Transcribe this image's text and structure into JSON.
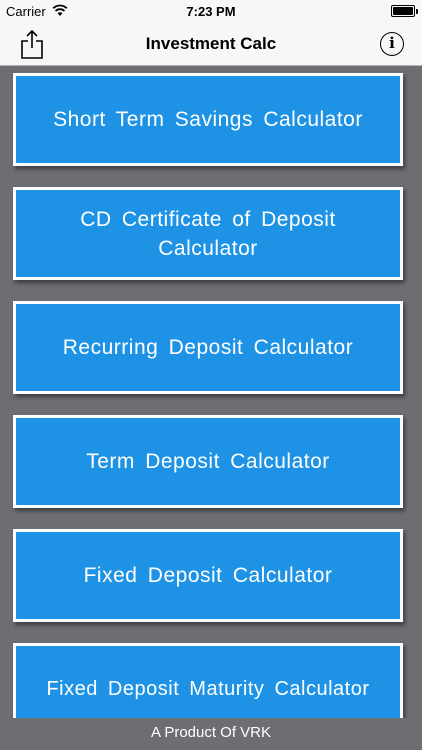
{
  "status_bar": {
    "carrier": "Carrier",
    "time": "7:23 PM"
  },
  "nav": {
    "title": "Investment Calc",
    "share_icon": "share-icon",
    "info_icon": "info-icon",
    "info_glyph": "i"
  },
  "calculators": [
    {
      "label": "Short Term Savings Calculator"
    },
    {
      "label": "CD  Certificate of Deposit\nCalculator"
    },
    {
      "label": "Recurring Deposit Calculator"
    },
    {
      "label": "Term Deposit Calculator"
    },
    {
      "label": "Fixed Deposit Calculator"
    },
    {
      "label": "Fixed Deposit Maturity Calculator"
    }
  ],
  "footer": {
    "text": "A Product Of VRK"
  },
  "colors": {
    "button_bg": "#1e93e6",
    "background": "#6d6e72",
    "bar_bg": "#f7f7f7"
  }
}
